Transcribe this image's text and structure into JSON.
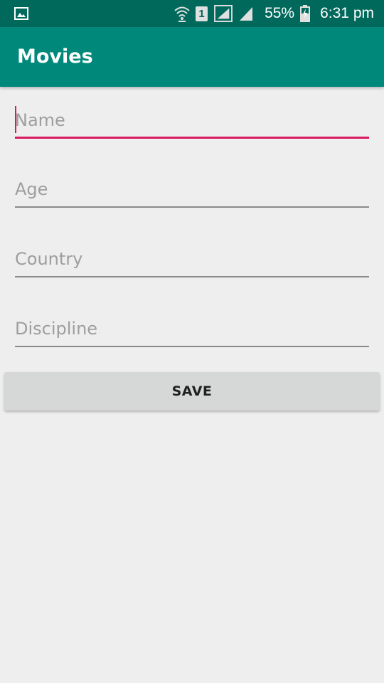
{
  "status_bar": {
    "battery": "55%",
    "time": "6:31 pm",
    "sim_slot": "1",
    "icons": [
      "gallery-icon",
      "wifi-icon",
      "sim-1-icon",
      "signal-icon",
      "signal-icon-2",
      "battery-charging-icon"
    ]
  },
  "app_bar": {
    "title": "Movies",
    "color": "#00897b",
    "status_color": "#00695c"
  },
  "form": {
    "name": {
      "placeholder": "Name",
      "value": ""
    },
    "age": {
      "placeholder": "Age",
      "value": ""
    },
    "country": {
      "placeholder": "Country",
      "value": ""
    },
    "discipline": {
      "placeholder": "Discipline",
      "value": ""
    },
    "accent_color": "#d81b60"
  },
  "save_button": {
    "label": "SAVE"
  }
}
